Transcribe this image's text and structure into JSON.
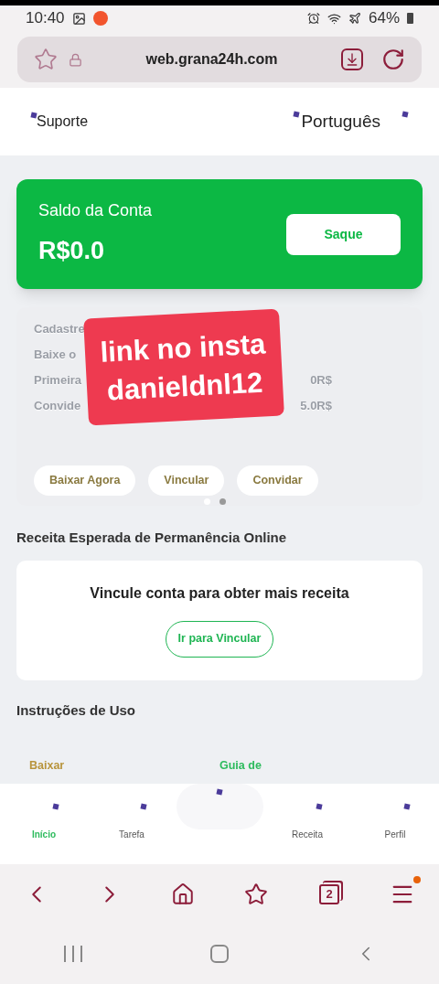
{
  "status_bar": {
    "time": "10:40",
    "battery": "64%"
  },
  "browser": {
    "url": "web.grana24h.com",
    "tab_count": "2",
    "menu_badge": true
  },
  "header": {
    "support": "Suporte",
    "language": "Português"
  },
  "balance": {
    "label": "Saldo da Conta",
    "amount": "R$0.0",
    "button": "Saque"
  },
  "promo": {
    "rows": [
      {
        "left": "Cadastre",
        "right": ""
      },
      {
        "left": "Baixe o",
        "right": ""
      },
      {
        "left": "Primeira",
        "right": "0R$"
      },
      {
        "left": "Convide",
        "right": "5.0R$"
      }
    ],
    "buttons": [
      "Baixar Agora",
      "Vincular",
      "Convidar"
    ],
    "dots": [
      {
        "selected": false
      },
      {
        "selected": true
      }
    ]
  },
  "sticker": {
    "lines": [
      "link no insta",
      "danieldnl12"
    ]
  },
  "online": {
    "title": "Receita Esperada de Permanência Online",
    "message": "Vincule conta para obter mais receita",
    "button": "Ir para Vincular"
  },
  "instructions": {
    "title": "Instruções de Uso",
    "items": [
      {
        "label": "Baixar",
        "color": "#b8943c"
      },
      {
        "label": "Guia de",
        "color": "#2dbb5d"
      }
    ]
  },
  "tabbar": [
    {
      "label": "Início",
      "selected": true
    },
    {
      "label": "Tarefa",
      "selected": false
    },
    {
      "kind": "center"
    },
    {
      "label": "Receita",
      "selected": false
    },
    {
      "label": "Perfil",
      "selected": false
    }
  ]
}
